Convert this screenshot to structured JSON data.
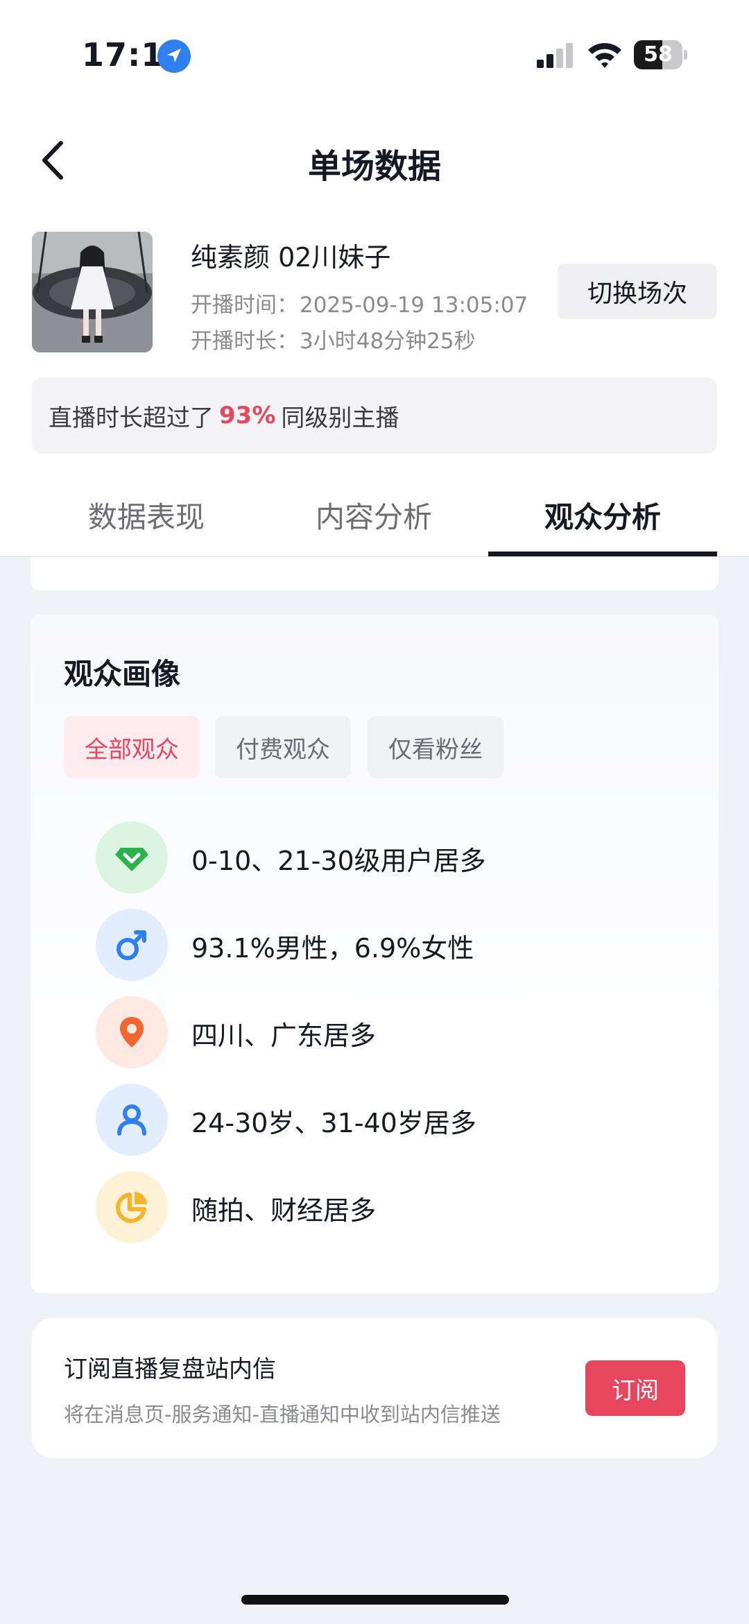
{
  "status_bar": {
    "time": "17:11",
    "battery": "58",
    "battery_level": 0.58
  },
  "nav": {
    "title": "单场数据",
    "back_icon": "chevron-left-icon"
  },
  "streamer": {
    "name": "纯素颜 02川妹子",
    "start_label": "开播时间：",
    "start_value": "2025-09-19 13:05:07",
    "duration_label": "开播时长：",
    "duration_value": "3小时48分钟25秒",
    "switch_label": "切换场次"
  },
  "banner": {
    "prefix": "直播时长超过了",
    "percent": "93%",
    "suffix": "同级别主播",
    "accent_color": "#e8465f"
  },
  "tabs": [
    {
      "label": "数据表现"
    },
    {
      "label": "内容分析"
    },
    {
      "label": "观众分析"
    }
  ],
  "audience": {
    "title": "观众画像",
    "filters": [
      {
        "label": "全部观众"
      },
      {
        "label": "付费观众"
      },
      {
        "label": "仅看粉丝"
      }
    ],
    "rows": [
      {
        "icon": "diamond-icon",
        "text": "0-10、21-30级用户居多",
        "color": "#2bb24c",
        "bg": "#dcf5e0"
      },
      {
        "icon": "male-icon",
        "text": "93.1%男性，6.9%女性",
        "color": "#2f7ff0",
        "bg": "#e2edfd"
      },
      {
        "icon": "location-pin-icon",
        "text": "四川、广东居多",
        "color": "#f0662e",
        "bg": "#fde9e1"
      },
      {
        "icon": "person-icon",
        "text": "24-30岁、31-40岁居多",
        "color": "#2f7ff0",
        "bg": "#e2edfd"
      },
      {
        "icon": "pie-chart-icon",
        "text": "随拍、财经居多",
        "color": "#f3b52c",
        "bg": "#fdf1d6"
      }
    ]
  },
  "subscribe": {
    "title": "订阅直播复盘站内信",
    "desc": "将在消息页-服务通知-直播通知中收到站内信推送",
    "button": "订阅"
  }
}
